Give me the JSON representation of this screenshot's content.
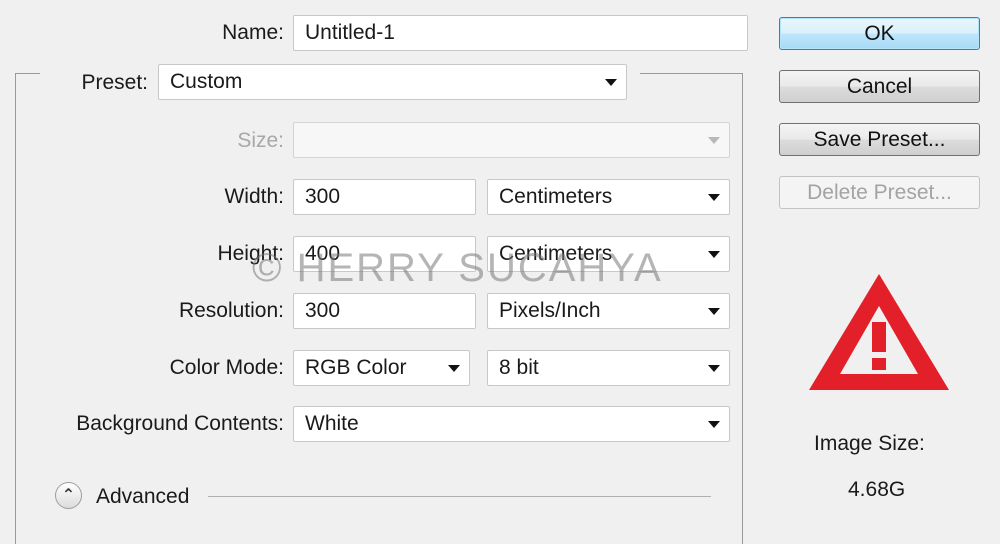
{
  "form": {
    "name": {
      "label": "Name:",
      "value": "Untitled-1"
    },
    "preset": {
      "label": "Preset:",
      "value": "Custom"
    },
    "size": {
      "label": "Size:",
      "value": ""
    },
    "width": {
      "label": "Width:",
      "value": "300",
      "unit": "Centimeters"
    },
    "height": {
      "label": "Height:",
      "value": "400",
      "unit": "Centimeters"
    },
    "resolution": {
      "label": "Resolution:",
      "value": "300",
      "unit": "Pixels/Inch"
    },
    "color_mode": {
      "label": "Color Mode:",
      "value": "RGB Color",
      "depth": "8 bit"
    },
    "background": {
      "label": "Background Contents:",
      "value": "White"
    },
    "advanced": {
      "label": "Advanced"
    }
  },
  "buttons": {
    "ok": "OK",
    "cancel": "Cancel",
    "save_preset": "Save Preset...",
    "delete_preset": "Delete Preset..."
  },
  "info": {
    "image_size_label": "Image Size:",
    "image_size_value": "4.68G",
    "warning_icon": "warning-triangle-icon",
    "warning_color": "#e3202a"
  },
  "watermark": "© HERRY SUCAHYA"
}
